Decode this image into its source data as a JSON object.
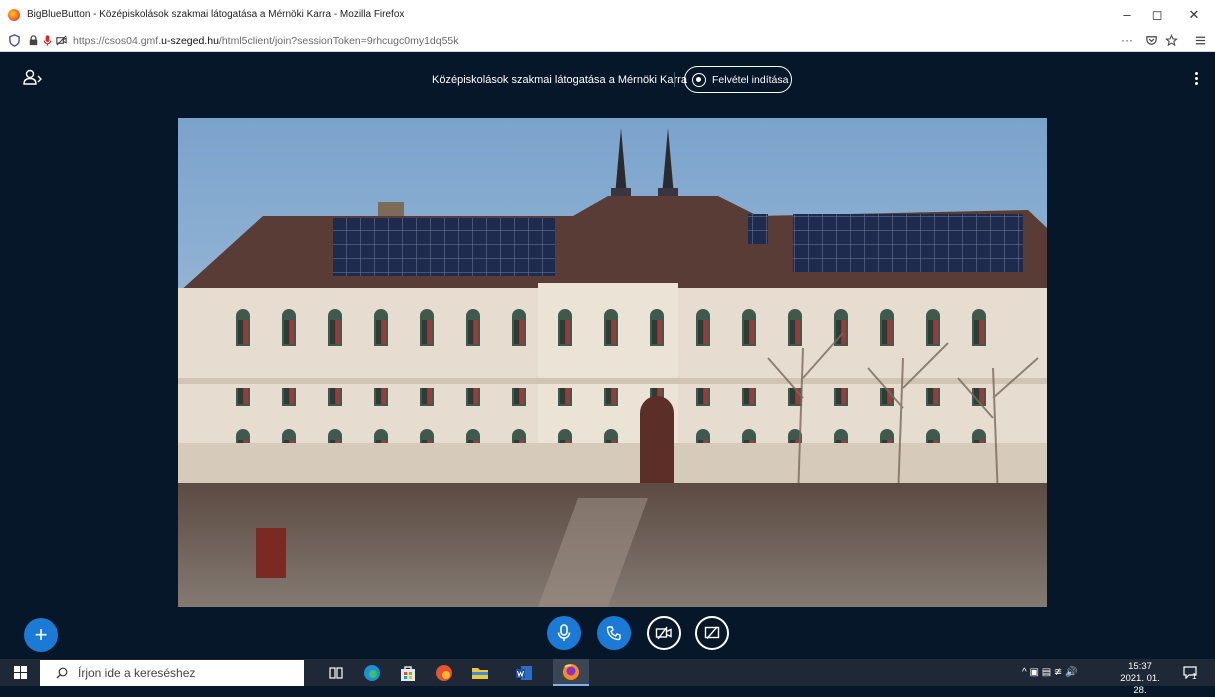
{
  "window": {
    "title": "BigBlueButton - Középiskolások szakmai látogatása a Mérnöki Karra - Mozilla Firefox",
    "controls": {
      "minimize": "–",
      "maximize": "◻",
      "close": "✕"
    }
  },
  "urlbar": {
    "url_prefix": "https://csos04.gmf.",
    "url_domain": "u-szeged.hu",
    "url_suffix": "/html5client/join?sessionToken=9rhcugc0my1dq55k",
    "more": "···"
  },
  "bbb": {
    "meeting_title": "Középiskolások szakmai látogatása a Mérnöki Karra",
    "record_label": "Felvétel indítása"
  },
  "actions": {
    "plus": "+"
  },
  "taskbar": {
    "search_placeholder": "Írjon ide a kereséshez",
    "time": "15:37",
    "date": "2021. 01. 28.",
    "tray_chevron": "^",
    "notification_count": "1"
  },
  "colors": {
    "bbb_background": "#06172a",
    "bbb_primary": "#1b7ad6",
    "taskbar": "#1e2836"
  },
  "icons": [
    "firefox-logo-icon",
    "shield-icon",
    "lock-icon",
    "microphone-indicator-icon",
    "camera-blocked-icon",
    "pocket-icon",
    "star-icon",
    "menu-icon",
    "user-list-icon",
    "record-icon",
    "options-icon",
    "plus-icon",
    "microphone-icon",
    "phone-icon",
    "camera-off-icon",
    "screen-share-off-icon",
    "windows-start-icon",
    "search-icon",
    "task-view-icon",
    "edge-icon",
    "store-icon",
    "office-icon",
    "file-explorer-icon",
    "word-icon",
    "firefox-icon",
    "notification-icon"
  ]
}
